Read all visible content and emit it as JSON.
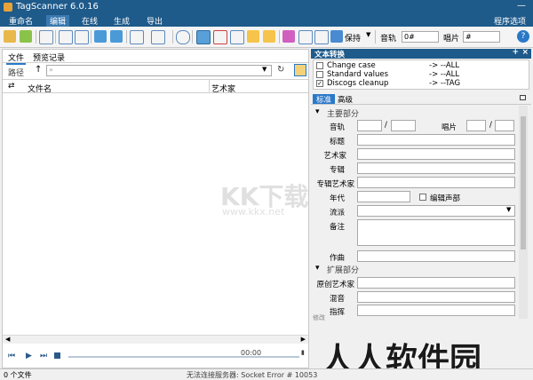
{
  "title": "TagScanner 6.0.16",
  "menu": {
    "rename": "重命名",
    "edit": "编辑",
    "online": "在线",
    "generate": "生成",
    "export": "导出",
    "options": "程序选项"
  },
  "toolbar": {
    "keep_label": "保持",
    "track_label": "音轨",
    "track_value": "0#",
    "disc_label": "唱片",
    "disc_value": "#"
  },
  "left": {
    "tab_files": "文件",
    "tab_preview": "预览记录",
    "path_label": "路径",
    "path_placeholder": "»",
    "col_filename": "文件名",
    "col_artist": "艺术家",
    "time": "00:00"
  },
  "right": {
    "header": "文本转换",
    "conversions": [
      {
        "name": "Change case",
        "target": "->  --ALL",
        "checked": false
      },
      {
        "name": "Standard values",
        "target": "->  --ALL",
        "checked": false
      },
      {
        "name": "Discogs cleanup",
        "target": "->  --TAG",
        "checked": true
      }
    ],
    "tab_standard": "标准",
    "tab_advanced": "高级",
    "section_main": "主要部分",
    "track": "音轨",
    "disc": "唱片",
    "title_label": "标题",
    "artist": "艺术家",
    "album": "专辑",
    "album_artist": "专辑艺术家",
    "year": "年代",
    "compilation": "编辑声部",
    "genre": "流派",
    "comment": "备注",
    "composer": "作曲",
    "section_ext": "扩展部分",
    "orig_artist": "原创艺术家",
    "remix": "混音",
    "conductor": "指挥",
    "bottom_note": "修改"
  },
  "status": {
    "files": "0 个文件",
    "server": "无法连接服务器: Socket Error # 10053"
  },
  "watermark": {
    "logo": "KK下载",
    "url": "www.kkx.net",
    "site": "人人软件园"
  }
}
